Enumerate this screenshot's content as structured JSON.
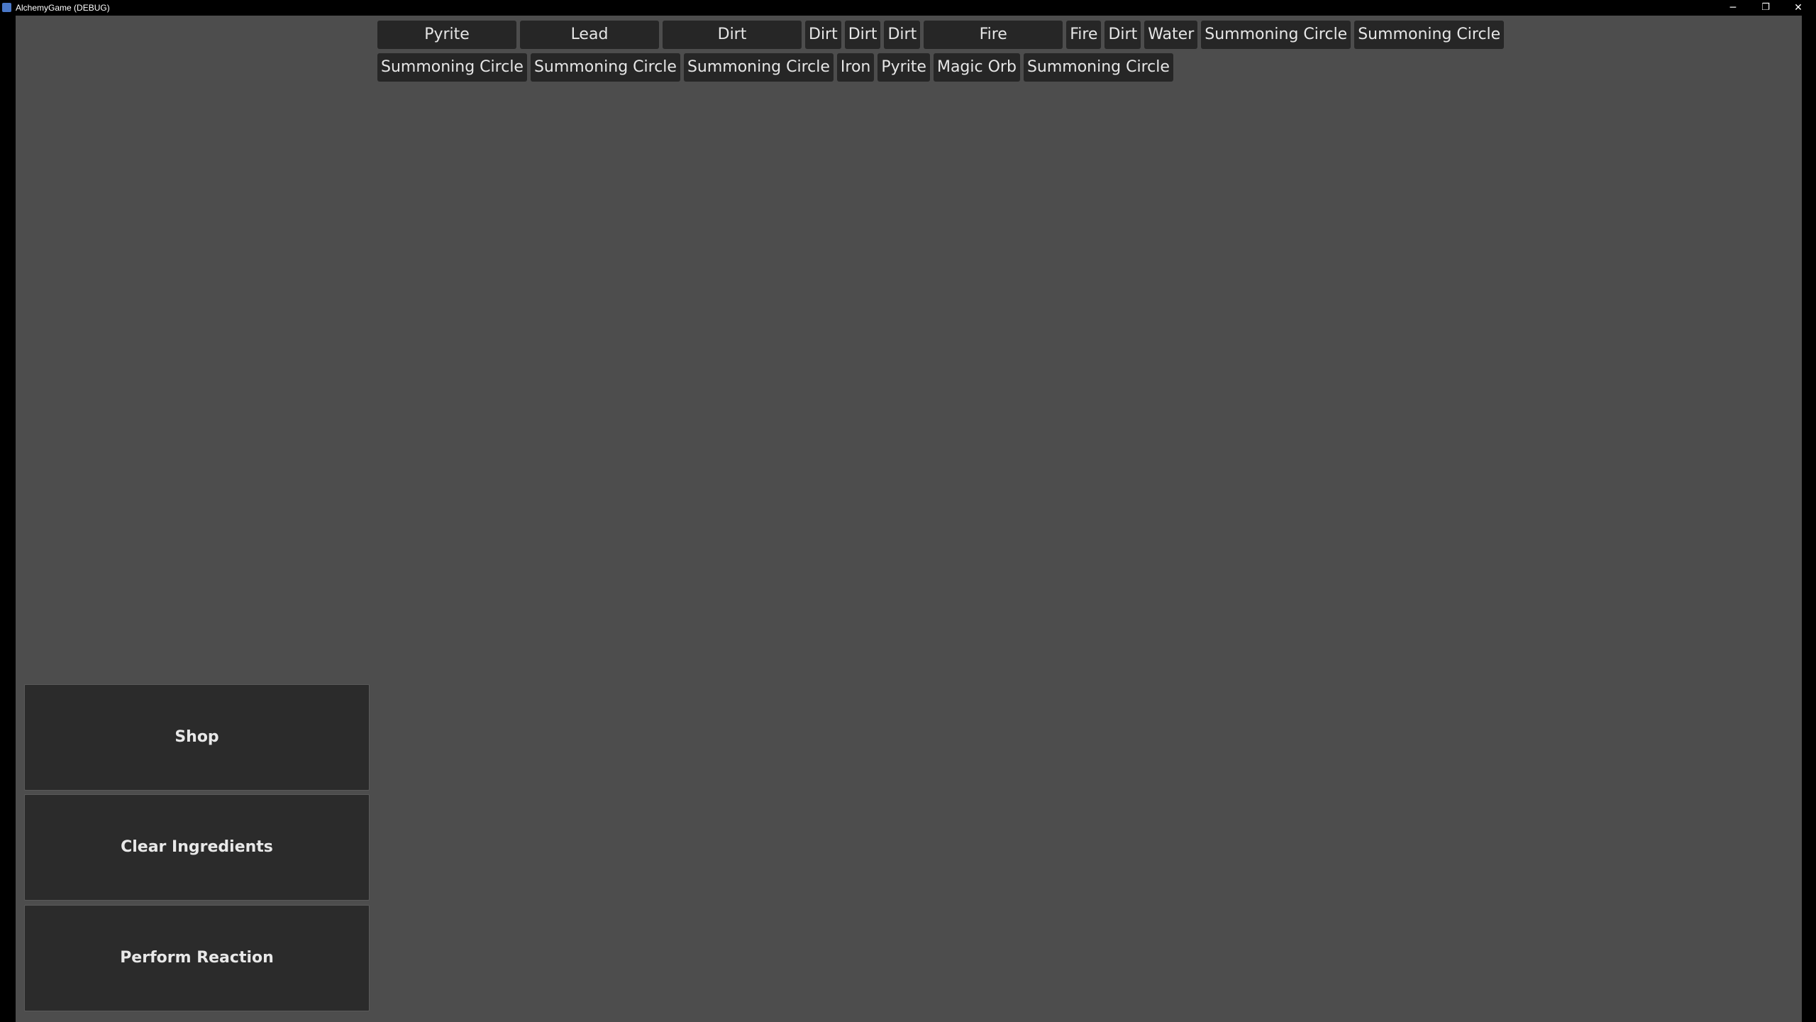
{
  "window": {
    "title": "AlchemyGame (DEBUG)",
    "controls": {
      "minimize": "─",
      "maximize": "❐",
      "close": "✕"
    }
  },
  "ingredients": {
    "row1": [
      {
        "label": "Pyrite",
        "wide": true
      },
      {
        "label": "Lead",
        "wide": true
      },
      {
        "label": "Dirt",
        "wide": true
      },
      {
        "label": "Dirt",
        "wide": false
      },
      {
        "label": "Dirt",
        "wide": false
      },
      {
        "label": "Dirt",
        "wide": false
      },
      {
        "label": "Fire",
        "wide": true
      },
      {
        "label": "Fire",
        "wide": false
      },
      {
        "label": "Dirt",
        "wide": false
      },
      {
        "label": "Water",
        "wide": false
      },
      {
        "label": "Summoning Circle",
        "wide": false
      },
      {
        "label": "Summoning Circle",
        "wide": false
      }
    ],
    "row2": [
      {
        "label": "Summoning Circle",
        "wide": false
      },
      {
        "label": "Summoning Circle",
        "wide": false
      },
      {
        "label": "Summoning Circle",
        "wide": false
      },
      {
        "label": "Iron",
        "wide": false
      },
      {
        "label": "Pyrite",
        "wide": false
      },
      {
        "label": "Magic Orb",
        "wide": false
      },
      {
        "label": "Summoning Circle",
        "wide": false
      }
    ]
  },
  "actions": {
    "shop_label": "Shop",
    "clear_label": "Clear Ingredients",
    "react_label": "Perform Reaction"
  },
  "colors": {
    "background": "#4d4d4d",
    "button": "#262626",
    "text": "#e6e6e6"
  }
}
